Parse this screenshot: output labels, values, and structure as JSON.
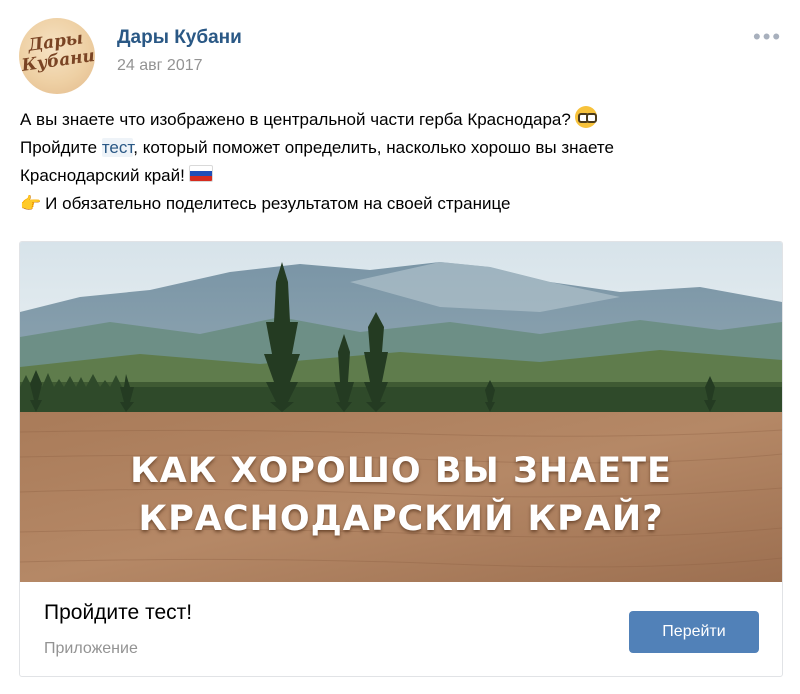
{
  "post": {
    "author": "Дары Кубани",
    "avatar_text_line1": "Дары",
    "avatar_text_line2": "Кубани",
    "date": "24 авг 2017",
    "menu_icon": "ellipsis-icon",
    "text_line1": "А вы знаете что изображено в центральной части герба Краснодара?",
    "text_line2_before": "Пройдите ",
    "text_line2_link": "тест",
    "text_line2_after": ", который поможет определить, насколько хорошо вы знаете",
    "text_line3": "Краснодарский край!",
    "text_line4_icon": "👉",
    "text_line4": "И обязательно поделитесь результатом на своей странице"
  },
  "card": {
    "headline_line1": "КАК ХОРОШО ВЫ ЗНАЕТЕ",
    "headline_line2": "КРАСНОДАРСКИЙ КРАЙ?",
    "title": "Пройдите тест!",
    "subtitle": "Приложение",
    "button_label": "Перейти"
  },
  "colors": {
    "link": "#2a5885",
    "button": "#5181b8",
    "meta_text": "#939393"
  }
}
